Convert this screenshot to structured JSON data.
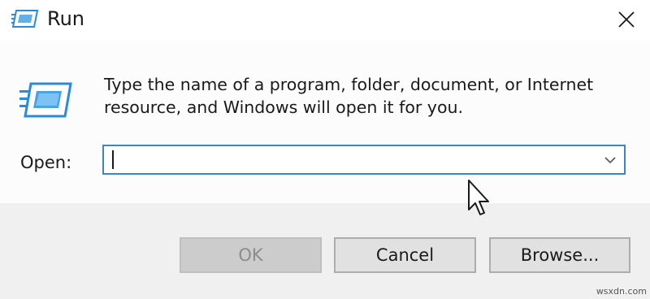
{
  "window": {
    "title": "Run",
    "title_icon": "run-icon",
    "close_icon": "close-icon"
  },
  "dialog": {
    "icon": "run-program-icon",
    "description": "Type the name of a program, folder, document, or Internet resource, and Windows will open it for you.",
    "open_label": "Open:",
    "open_value": "",
    "dropdown_icon": "chevron-down-icon"
  },
  "buttons": {
    "ok": "OK",
    "cancel": "Cancel",
    "browse": "Browse..."
  },
  "watermark": "wsxdn.com",
  "colors": {
    "focus_border": "#3c85c6",
    "footer_bg": "#f0f0f0",
    "icon_blue": "#2b8bd4",
    "disabled_text": "#8c8c8c"
  }
}
